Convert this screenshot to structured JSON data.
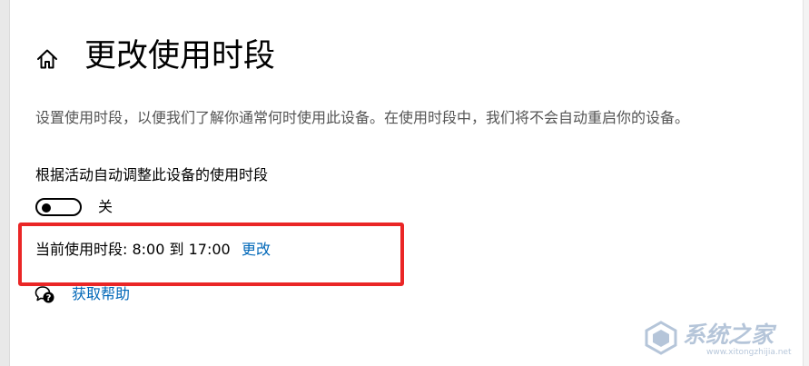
{
  "header": {
    "title": "更改使用时段",
    "home_icon": "home-icon"
  },
  "description": "设置使用时段，以便我们了解你通常何时使用此设备。在使用时段中，我们将不会自动重启你的设备。",
  "auto_adjust": {
    "label": "根据活动自动调整此设备的使用时段",
    "toggle_state": "关",
    "toggle_on": false
  },
  "current_hours": {
    "text": "当前使用时段: 8:00 到 17:00",
    "change_link": "更改"
  },
  "help": {
    "icon": "help-chat-icon",
    "label": "获取帮助"
  },
  "watermark": {
    "text": "系统之家",
    "url": "www.xitongzhijia.net"
  },
  "colors": {
    "link": "#0067b8",
    "highlight": "#ea2626",
    "description_text": "#545454"
  }
}
